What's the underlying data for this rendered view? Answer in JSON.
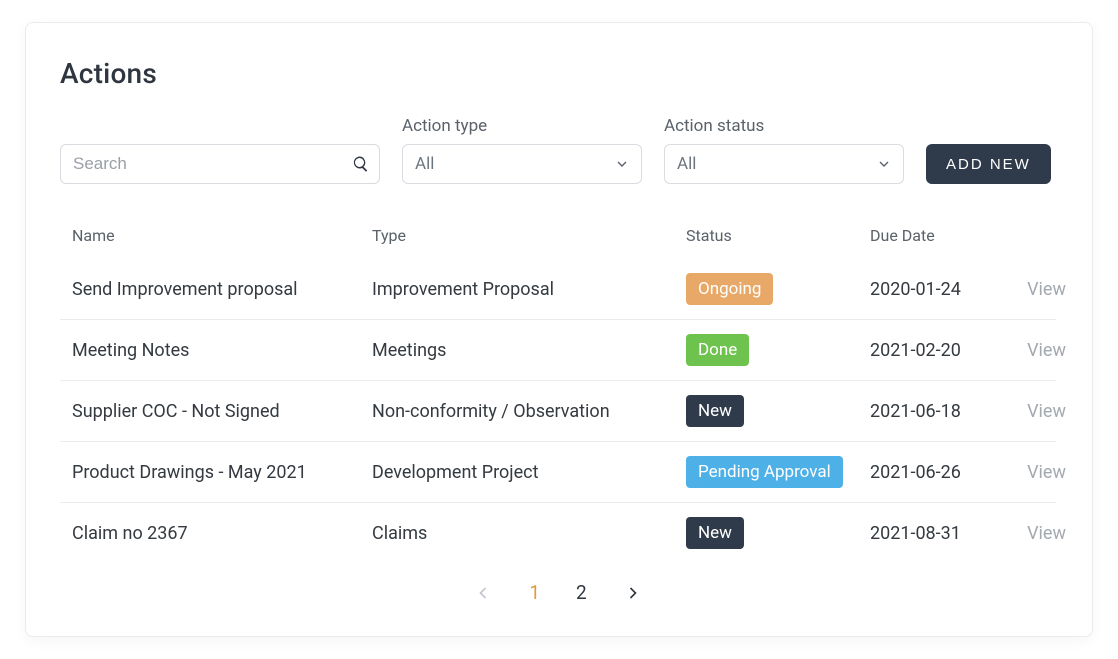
{
  "title": "Actions",
  "search": {
    "placeholder": "Search"
  },
  "filters": {
    "type": {
      "label": "Action type",
      "value": "All"
    },
    "status": {
      "label": "Action status",
      "value": "All"
    }
  },
  "add_button": "ADD NEW",
  "columns": [
    "Name",
    "Type",
    "Status",
    "Due Date",
    ""
  ],
  "status_styles": {
    "Ongoing": "badge-ongoing",
    "Done": "badge-done",
    "New": "badge-new",
    "Pending Approval": "badge-pending"
  },
  "rows": [
    {
      "name": "Send Improvement proposal",
      "type": "Improvement Proposal",
      "status": "Ongoing",
      "due": "2020-01-24",
      "action": "View"
    },
    {
      "name": "Meeting Notes",
      "type": "Meetings",
      "status": "Done",
      "due": "2021-02-20",
      "action": "View"
    },
    {
      "name": "Supplier COC - Not Signed",
      "type": "Non-conformity / Observation",
      "status": "New",
      "due": "2021-06-18",
      "action": "View"
    },
    {
      "name": "Product Drawings - May 2021",
      "type": "Development Project",
      "status": "Pending Approval",
      "due": "2021-06-26",
      "action": "View"
    },
    {
      "name": "Claim no 2367",
      "type": "Claims",
      "status": "New",
      "due": "2021-08-31",
      "action": "View"
    }
  ],
  "pagination": {
    "pages": [
      "1",
      "2"
    ],
    "current": 1
  }
}
